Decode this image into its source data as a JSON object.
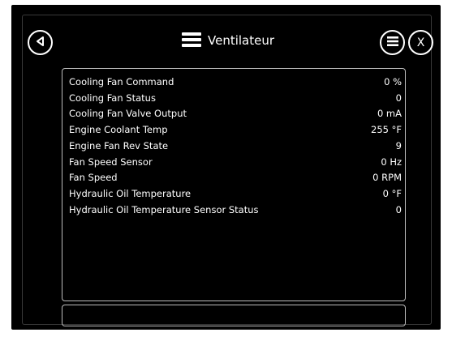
{
  "header": {
    "title": "Ventilateur",
    "close_label": "X"
  },
  "icons": {
    "back": "back-triangle-icon",
    "title": "hamburger-icon",
    "menu": "menu-circle-icon",
    "close": "close-icon"
  },
  "params": [
    {
      "label": "Cooling Fan Command",
      "value": "0 %"
    },
    {
      "label": "Cooling Fan Status",
      "value": "0"
    },
    {
      "label": "Cooling Fan Valve Output",
      "value": "0 mA"
    },
    {
      "label": "Engine Coolant Temp",
      "value": "255 °F"
    },
    {
      "label": "Engine Fan Rev State",
      "value": "9"
    },
    {
      "label": "Fan Speed Sensor",
      "value": "0 Hz"
    },
    {
      "label": "Fan Speed",
      "value": "0 RPM"
    },
    {
      "label": "Hydraulic Oil Temperature",
      "value": "0 °F"
    },
    {
      "label": "Hydraulic Oil Temperature Sensor Status",
      "value": "0"
    }
  ],
  "status_text": ""
}
